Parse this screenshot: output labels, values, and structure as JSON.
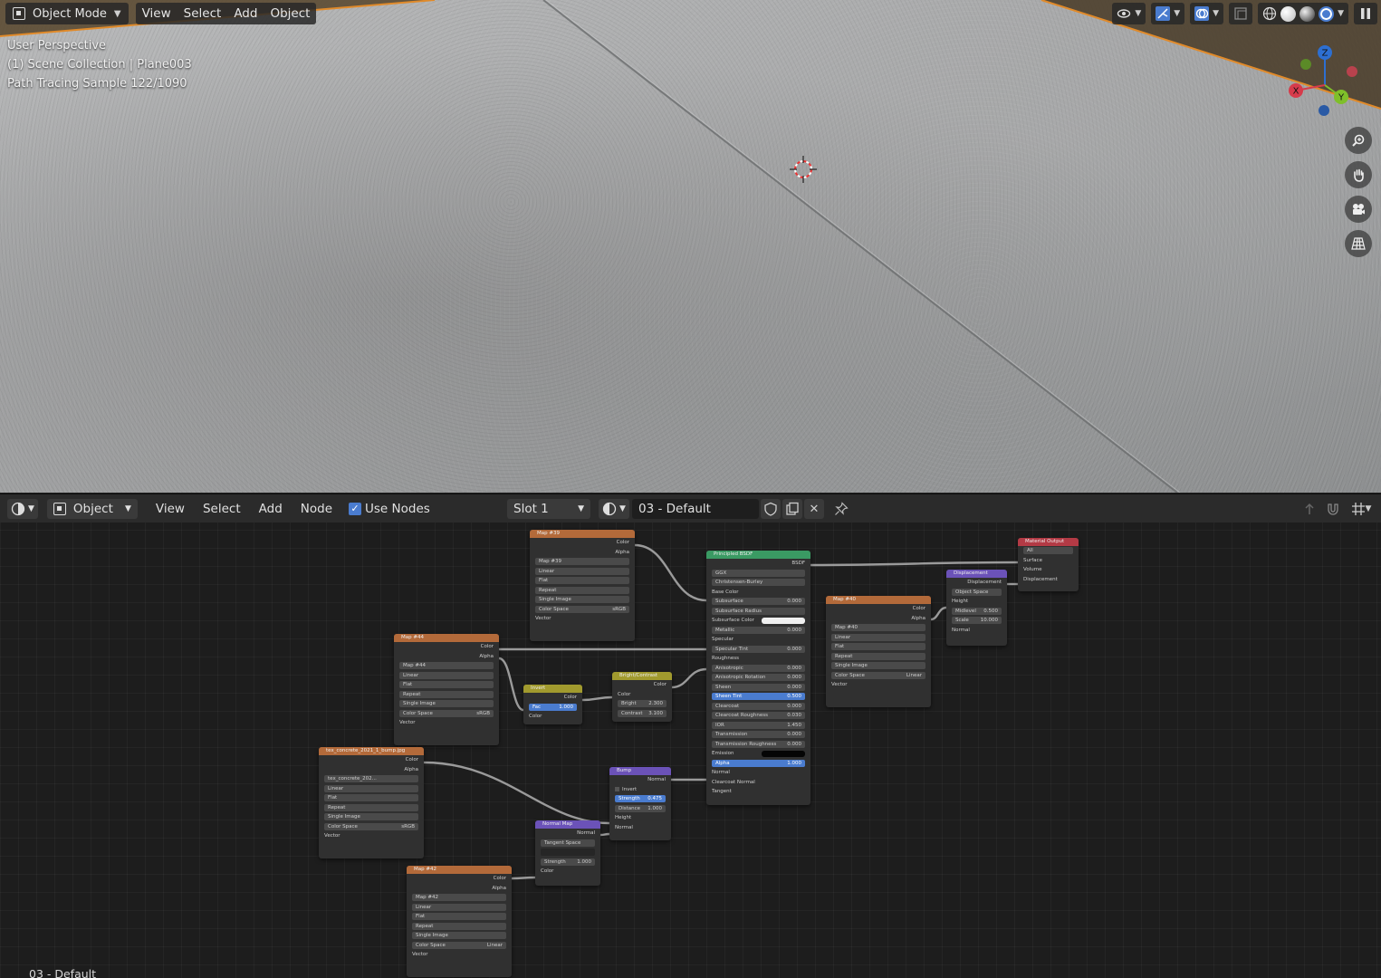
{
  "viewport": {
    "mode_label": "Object Mode",
    "menus": [
      "View",
      "Select",
      "Add",
      "Object"
    ],
    "info_view": "User Perspective",
    "info_collection": "(1) Scene Collection | Plane003",
    "info_render": "Path Tracing Sample 122/1090",
    "gizmo_labels": {
      "z": "Z",
      "y": "Y",
      "x": "X"
    },
    "icons": [
      "visibility-eye-icon",
      "gizmo-icon",
      "overlay-icon",
      "xray-icon",
      "wireframe-shading-icon",
      "solid-shading-icon",
      "material-shading-icon",
      "rendered-shading-icon",
      "pause-icon",
      "zoom-icon",
      "hand-pan-icon",
      "camera-icon",
      "grid-ortho-icon",
      "3d-cursor-icon"
    ]
  },
  "node_editor": {
    "editor_type_icon": "shader-editor-icon",
    "object_dropdown": "Object",
    "menus": [
      "View",
      "Select",
      "Add",
      "Node"
    ],
    "use_nodes_label": "Use Nodes",
    "slot_label": "Slot 1",
    "material_name": "03 - Default",
    "footer_label": "03 - Default"
  },
  "nodes": {
    "map39": {
      "title": "Map #39",
      "out_color": "Color",
      "out_alpha": "Alpha",
      "image": "Map #39",
      "interp": "Linear",
      "proj": "Flat",
      "ext": "Repeat",
      "src": "Single Image",
      "cs_label": "Color Space",
      "cs_value": "sRGB",
      "in_vector": "Vector"
    },
    "map44": {
      "title": "Map #44",
      "out_color": "Color",
      "out_alpha": "Alpha",
      "image": "Map #44",
      "interp": "Linear",
      "proj": "Flat",
      "ext": "Repeat",
      "src": "Single Image",
      "cs_label": "Color Space",
      "cs_value": "sRGB",
      "in_vector": "Vector"
    },
    "bump_tex": {
      "title": "tex_concrete_2021_1_bump.jpg",
      "out_color": "Color",
      "out_alpha": "Alpha",
      "image": "tex_concrete_202...",
      "interp": "Linear",
      "proj": "Flat",
      "ext": "Repeat",
      "src": "Single Image",
      "cs_label": "Color Space",
      "cs_value": "sRGB",
      "in_vector": "Vector"
    },
    "map42": {
      "title": "Map #42",
      "out_color": "Color",
      "out_alpha": "Alpha",
      "image": "Map #42",
      "interp": "Linear",
      "proj": "Flat",
      "ext": "Repeat",
      "src": "Single Image",
      "cs_label": "Color Space",
      "cs_value": "Linear",
      "in_vector": "Vector"
    },
    "map40": {
      "title": "Map #40",
      "out_color": "Color",
      "out_alpha": "Alpha",
      "image": "Map #40",
      "interp": "Linear",
      "proj": "Flat",
      "ext": "Repeat",
      "src": "Single Image",
      "cs_label": "Color Space",
      "cs_value": "Linear",
      "in_vector": "Vector"
    },
    "invert": {
      "title": "Invert",
      "out_color": "Color",
      "fac_label": "Fac",
      "fac_value": "1.000",
      "in_color": "Color"
    },
    "brightcontrast": {
      "title": "Bright/Contrast",
      "out_color": "Color",
      "in_color": "Color",
      "bright_label": "Bright",
      "bright_value": "2.300",
      "contrast_label": "Contrast",
      "contrast_value": "3.100"
    },
    "bump": {
      "title": "Bump",
      "out_normal": "Normal",
      "invert_label": "Invert",
      "strength_label": "Strength",
      "strength_value": "0.475",
      "distance_label": "Distance",
      "distance_value": "1.000",
      "in_height": "Height",
      "in_normal": "Normal"
    },
    "normalmap": {
      "title": "Normal Map",
      "out_normal": "Normal",
      "space": "Tangent Space",
      "uv": "",
      "strength_label": "Strength",
      "strength_value": "1.000",
      "in_color": "Color"
    },
    "bsdf": {
      "title": "Principled BSDF",
      "out": "BSDF",
      "distribution": "GGX",
      "subsurface_method": "Christensen-Burley",
      "rows": [
        {
          "label": "Base Color",
          "kind": "socket"
        },
        {
          "label": "Subsurface",
          "value": "0.000"
        },
        {
          "label": "Subsurface Radius",
          "kind": "dd"
        },
        {
          "label": "Subsurface Color",
          "kind": "swatch-white"
        },
        {
          "label": "Metallic",
          "value": "0.000"
        },
        {
          "label": "Specular",
          "kind": "socket"
        },
        {
          "label": "Specular Tint",
          "value": "0.000"
        },
        {
          "label": "Roughness",
          "kind": "socket"
        },
        {
          "label": "Anisotropic",
          "value": "0.000"
        },
        {
          "label": "Anisotropic Rotation",
          "value": "0.000"
        },
        {
          "label": "Sheen",
          "value": "0.000"
        },
        {
          "label": "Sheen Tint",
          "value": "0.500",
          "kind": "blue"
        },
        {
          "label": "Clearcoat",
          "value": "0.000"
        },
        {
          "label": "Clearcoat Roughness",
          "value": "0.030"
        },
        {
          "label": "IOR",
          "value": "1.450"
        },
        {
          "label": "Transmission",
          "value": "0.000"
        },
        {
          "label": "Transmission Roughness",
          "value": "0.000"
        },
        {
          "label": "Emission",
          "kind": "swatch-black"
        },
        {
          "label": "Alpha",
          "value": "1.000",
          "kind": "blue"
        },
        {
          "label": "Normal",
          "kind": "socket"
        },
        {
          "label": "Clearcoat Normal",
          "kind": "socket"
        },
        {
          "label": "Tangent",
          "kind": "socket"
        }
      ]
    },
    "displacement": {
      "title": "Displacement",
      "out": "Displacement",
      "space": "Object Space",
      "in_height": "Height",
      "midlevel_label": "Midlevel",
      "midlevel_value": "0.500",
      "scale_label": "Scale",
      "scale_value": "10.000",
      "in_normal": "Normal"
    },
    "output": {
      "title": "Material Output",
      "target": "All",
      "in_surface": "Surface",
      "in_volume": "Volume",
      "in_displacement": "Displacement"
    }
  }
}
